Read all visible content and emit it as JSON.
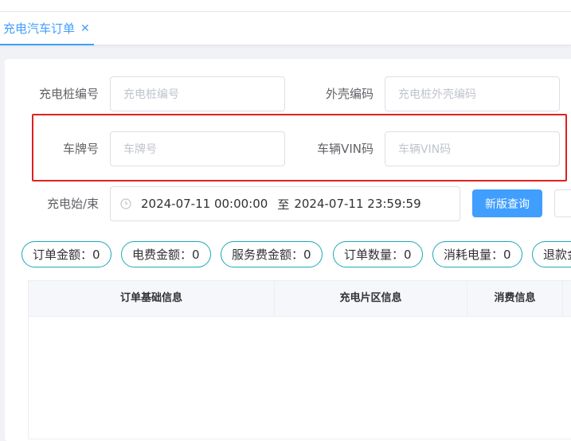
{
  "tabs": [
    {
      "label": "充电汽车订单",
      "active": true
    }
  ],
  "form": {
    "pile_code": {
      "label": "充电桩编号",
      "placeholder": "充电桩编号"
    },
    "shell_code": {
      "label": "外壳编码",
      "placeholder": "充电桩外壳编码"
    },
    "plate": {
      "label": "车牌号",
      "placeholder": "车牌号"
    },
    "vin": {
      "label": "车辆VIN码",
      "placeholder": "车辆VIN码"
    },
    "date_range": {
      "label": "充电始/束",
      "start": "2024-07-11 00:00:00",
      "separator": "至",
      "end": "2024-07-11 23:59:59"
    },
    "query_button": "新版查询"
  },
  "stats": [
    {
      "label": "订单金额：0"
    },
    {
      "label": "电费金额：0"
    },
    {
      "label": "服务费金额：0"
    },
    {
      "label": "订单数量：0"
    },
    {
      "label": "消耗电量：0"
    },
    {
      "label": "退款金"
    }
  ],
  "table": {
    "columns": [
      "订单基础信息",
      "充电片区信息",
      "消费信息"
    ]
  },
  "colors": {
    "accent": "#409eff",
    "pill_border": "#1ba9b5",
    "highlight_box": "#e02020"
  }
}
